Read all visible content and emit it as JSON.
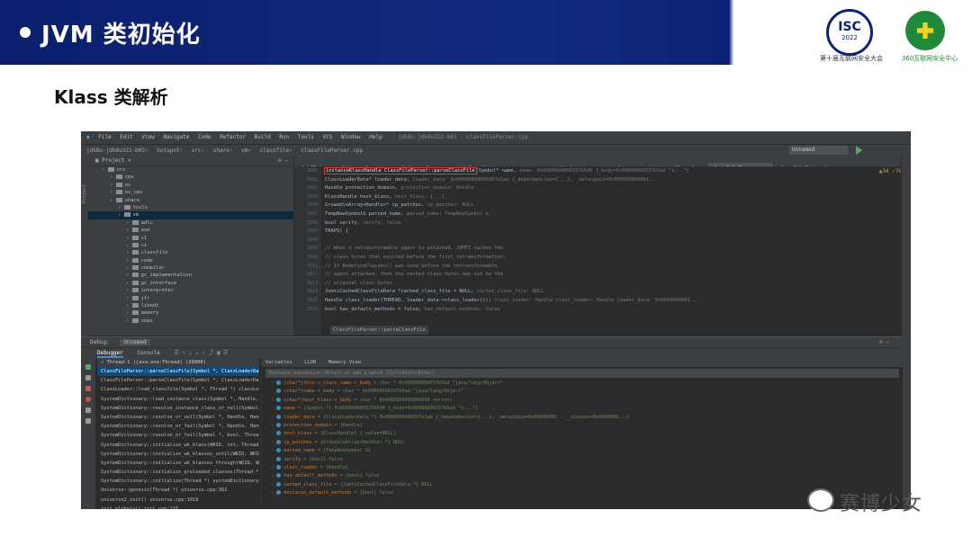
{
  "slide": {
    "title": "JVM 类初始化",
    "subtitle": "Klass 类解析",
    "logos": {
      "isc_text": "ISC",
      "isc_year": "2022",
      "isc_caption": "第十届互联网安全大会",
      "caption_360": "360互联网安全中心"
    },
    "watermark": "赛博少女"
  },
  "ide": {
    "menu": [
      "File",
      "Edit",
      "View",
      "Navigate",
      "Code",
      "Refactor",
      "Build",
      "Run",
      "Tools",
      "VCS",
      "Window",
      "Help"
    ],
    "window_title": "jdk8u-jdk8u322-b03 · classFileParser.cpp",
    "breadcrumb": [
      "jdk8u-jdk8u322-b03",
      "hotspot",
      "src",
      "share",
      "vm",
      "classfile",
      "classFileParser.cpp"
    ],
    "run_config": "Unnamed",
    "project_label": "Project",
    "project_tree": [
      {
        "name": "src",
        "depth": 1
      },
      {
        "name": "cpu",
        "depth": 2
      },
      {
        "name": "os",
        "depth": 2
      },
      {
        "name": "os_cpu",
        "depth": 2
      },
      {
        "name": "share",
        "depth": 2
      },
      {
        "name": "tools",
        "depth": 3
      },
      {
        "name": "vm",
        "depth": 3
      },
      {
        "name": "adlc",
        "depth": 4
      },
      {
        "name": "asm",
        "depth": 4
      },
      {
        "name": "c1",
        "depth": 4
      },
      {
        "name": "ci",
        "depth": 4
      },
      {
        "name": "classfile",
        "depth": 4
      },
      {
        "name": "code",
        "depth": 4
      },
      {
        "name": "compiler",
        "depth": 4
      },
      {
        "name": "gc_implementation",
        "depth": 4
      },
      {
        "name": "gc_interface",
        "depth": 4
      },
      {
        "name": "interpreter",
        "depth": 4
      },
      {
        "name": "jfr",
        "depth": 4
      },
      {
        "name": "libadt",
        "depth": 4
      },
      {
        "name": "memory",
        "depth": 4
      },
      {
        "name": "oops",
        "depth": 4
      }
    ],
    "tabs": [
      "c1_LIR.hpp",
      "c1_LinearScan.hpp",
      "c1_LinearScan.cpp",
      "c1_Compilation.cpp",
      "sas.cpp",
      "method.cpp",
      "resourceArea.cpp",
      "instanceKlass.hpp",
      "classFileParser.cpp",
      "classFileParser.hpp"
    ],
    "active_tab": "classFileParser.cpp",
    "inspection": "▲34 ✓76",
    "line_numbers": [
      "3600",
      "3601",
      "3602",
      "3603",
      "3604",
      "3605",
      "3606",
      "3607",
      "3608",
      "3609",
      "3610",
      "3611",
      "3612",
      "3613",
      "3614",
      "3615",
      "3616",
      "3617"
    ],
    "code_lines": [
      {
        "pre": "",
        "hl": "instanceKlassHandle ClassFileParser::parseClassFile",
        "text": "(Symbol* name,",
        "hint": "  name: 0x0000000000337b5d0 {_body=0x00000000337b5ed \"s...\"}"
      },
      {
        "text": "                     ClassLoaderData* loader_data,",
        "hint": "  loader_data: 0x00000000000367e1ab {_dependencies={...}, _metaspace=0x0000000000b1.."
      },
      {
        "text": "                     Handle protection_domain,",
        "hint": "  protection_domain: Handle"
      },
      {
        "text": "                     KlassHandle host_klass,",
        "hint": "  host_klass: {...}"
      },
      {
        "text": "                     GrowableArray<Handle>* cp_patches,",
        "hint": "  cp_patches: NULL"
      },
      {
        "text": "                     TempNewSymbol& parsed_name,",
        "hint": "  parsed_name: TempNewSymbol &"
      },
      {
        "text": "                     bool verify,",
        "hint": "  verify: false"
      },
      {
        "text": "                     TRAPS) {",
        "hint": ""
      },
      {
        "text": "",
        "hint": ""
      },
      {
        "cls": "cm",
        "text": "  // When a retransformable agent is attached, JVMTI caches the",
        "hint": ""
      },
      {
        "cls": "cm",
        "text": "  // class bytes that existed before the first retransformation.",
        "hint": ""
      },
      {
        "cls": "cm",
        "text": "  // If RedefineClasses() was used before the retransformable",
        "hint": ""
      },
      {
        "cls": "cm",
        "text": "  // agent attached, then the cached class bytes may not be the",
        "hint": ""
      },
      {
        "cls": "cm",
        "text": "  // original class bytes.",
        "hint": ""
      },
      {
        "text": "  JvmtiCachedClassFileData *cached_class_file = NULL;",
        "hint": "  cached_class_file: NULL"
      },
      {
        "text": "  Handle class_loader(THREAD, loader_data->class_loader());",
        "hint": "  class_loader: Handle   class_loader: Handle   loader_data: 0x0000000001..."
      },
      {
        "text": "  bool has_default_methods = false;",
        "hint": "  has_default_methods: false"
      }
    ],
    "editor_crumb": "ClassFileParser::parseClassFile",
    "debug": {
      "label": "Debug:",
      "session": "Unnamed",
      "tabs": [
        "Debugger",
        "Console"
      ],
      "thread": "Thread-1 (java.exe:Thread) (26808)",
      "frames": [
        "ClassFileParser::parseClassFile(Symbol *, ClassLoaderData *, Handle...",
        "ClassFileParser::parseClassFile(Symbol *, ClassLoaderData *, Handle...",
        "ClassLoader::load_classfile(Symbol *, Thread *) classLoader.cpp",
        "SystemDictionary::load_instance_class(Symbol *, Handle, Thread *)",
        "SystemDictionary::resolve_instance_class_or_null(Symbol *, Handle..",
        "SystemDictionary::resolve_or_null(Symbol *, Handle, Handle, Thread..",
        "SystemDictionary::resolve_or_fail(Symbol *, Handle, Handle, bool..",
        "SystemDictionary::resolve_or_fail(Symbol *, bool, Thread *) system..",
        "SystemDictionary::initialize_wk_klass(WKID, int, Thread *) system..",
        "SystemDictionary::initialize_wk_klasses_until(WKID, WKID &, Thread..",
        "SystemDictionary::initialize_wk_klasses_through(WKID, WKID &, Thr..",
        "SystemDictionary::initialize_preloaded_classes(Thread *) systemDi..",
        "SystemDictionary::initialize(Thread *) systemDictionary.cpp:1904",
        "Universe::genesis(Thread *) universe.cpp:362",
        "universe2_init() universe.cpp:1018",
        "init_globals() init.cpp:118"
      ],
      "vars_tabs": [
        "Variables",
        "LLDB",
        "Memory View"
      ],
      "eval_placeholder": "Evaluate expression (Enter) or add a watch (Ctrl+Shift+Enter)",
      "variables": [
        {
          "n": "(char*)this->_class_name->_body",
          "v": " = char * 0x000000000337b5ed \"java/lang/Object\""
        },
        {
          "n": "(char*)name->_body",
          "v": " = char * 0x00000000337b5ed \"java/lang/Object\""
        },
        {
          "n": "(char*)host_klass->_body",
          "v": " = char * 0x0000000000000000 <error>"
        },
        {
          "n": "name",
          "v": " = {Symbol *} 0x000000000337b5d0 {_body=0x00000000337b5ed \"s...\"}"
        },
        {
          "n": "loader_data",
          "v": " = {ClassLoaderData *} 0x0000000000367e1ab {_dependencies={...}, _metaspace=0x00000000... _klasses=0x0000000...}"
        },
        {
          "n": "protection_domain",
          "v": " = {Handle}"
        },
        {
          "n": "host_klass",
          "v": " = {KlassHandle} {_value=NULL}"
        },
        {
          "n": "cp_patches",
          "v": " = {GrowableArray<Handle> *} NULL"
        },
        {
          "n": "parsed_name",
          "v": " = {TempNewSymbol &}"
        },
        {
          "n": "verify",
          "v": " = {bool} false"
        },
        {
          "n": "class_loader",
          "v": " = {Handle}"
        },
        {
          "n": "has_default_methods",
          "v": " = {bool} false"
        },
        {
          "n": "cached_class_file",
          "v": " = {JvmtiCachedClassFileData *} NULL"
        },
        {
          "n": "declares_default_methods",
          "v": " = {bool} false"
        }
      ]
    }
  }
}
